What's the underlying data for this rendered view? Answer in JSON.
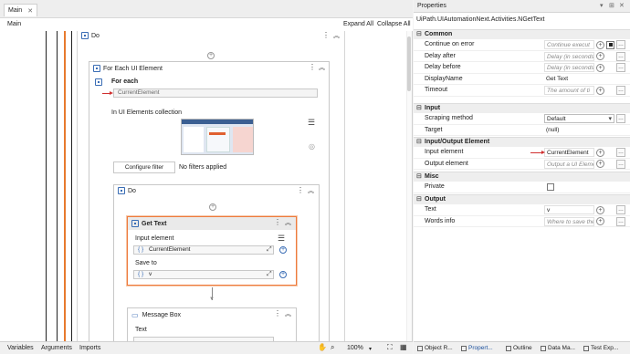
{
  "window": {
    "tab_title": "Main",
    "breadcrumb": "Main",
    "expand_all": "Expand All",
    "collapse_all": "Collapse All"
  },
  "designer": {
    "outer_do_title": "Do",
    "foreach": {
      "title": "For Each UI Element",
      "for_each_label": "For each",
      "for_each_value": "CurrentElement",
      "collection_label": "In UI Elements collection",
      "configure_filter": "Configure filter",
      "filter_status": "No filters applied"
    },
    "inner_do_title": "Do",
    "get_text": {
      "title": "Get Text",
      "input_label": "Input element",
      "input_value": "CurrentElement",
      "save_label": "Save to",
      "save_value": "v"
    },
    "message_box": {
      "title": "Message Box",
      "text_label": "Text"
    }
  },
  "bottom_tabs": [
    "Variables",
    "Arguments",
    "Imports"
  ],
  "zoom": "100%",
  "properties": {
    "panel_title": "Properties",
    "class_name": "UiPath.UIAutomationNext.Activities.NGetText",
    "sections": [
      {
        "name": "Common",
        "rows": [
          {
            "name": "Continue on error",
            "value": "Continue execut",
            "kind": "ph"
          },
          {
            "name": "Delay after",
            "value": "Delay (in seconds) a",
            "kind": "ph"
          },
          {
            "name": "Delay before",
            "value": "Delay (in seconds) b",
            "kind": "ph"
          },
          {
            "name": "DisplayName",
            "value": "Get Text",
            "kind": "plain"
          },
          {
            "name": "Timeout",
            "value": "The amount of ti",
            "kind": "ph"
          }
        ]
      },
      {
        "name": "Input",
        "rows": [
          {
            "name": "Scraping method",
            "value": "Default",
            "kind": "drop"
          },
          {
            "name": "Target",
            "value": "(null)",
            "kind": "plain"
          }
        ]
      },
      {
        "name": "Input/Output Element",
        "rows": [
          {
            "name": "Input element",
            "value": "CurrentElement",
            "kind": "set"
          },
          {
            "name": "Output element",
            "value": "Output a UI Element",
            "kind": "ph"
          }
        ]
      },
      {
        "name": "Misc",
        "rows": [
          {
            "name": "Private",
            "value": "",
            "kind": "check"
          }
        ]
      },
      {
        "name": "Output",
        "rows": [
          {
            "name": "Text",
            "value": "v",
            "kind": "set"
          },
          {
            "name": "Words info",
            "value": "Where to save the w",
            "kind": "ph"
          }
        ]
      }
    ],
    "tabs": [
      "Object R...",
      "Propert...",
      "Outline",
      "Data Ma...",
      "Test Exp..."
    ],
    "active_tab": "Propert..."
  },
  "colors": {
    "accent_orange": "#ee7a3c",
    "arrow_red": "#d03030",
    "link_blue": "#1a4f9c"
  }
}
